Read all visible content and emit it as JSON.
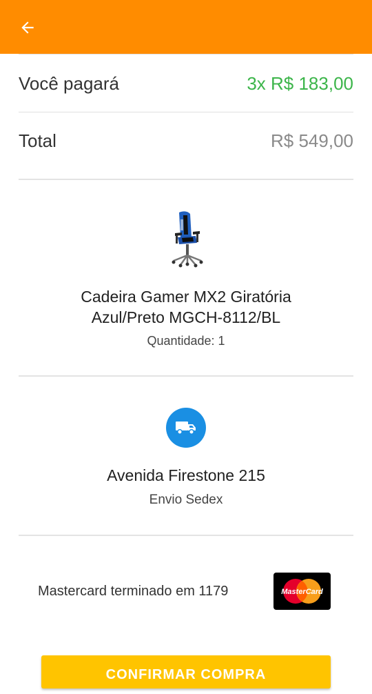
{
  "header": {
    "back_icon": "arrow-left-icon",
    "bg_color": "#ff8c00"
  },
  "summary": {
    "pay_label": "Você pagará",
    "pay_value": "3x R$ 183,00",
    "total_label": "Total",
    "total_value": "R$ 549,00"
  },
  "product": {
    "image_icon": "gaming-chair-image",
    "name_line1": "Cadeira Gamer MX2 Giratória",
    "name_line2": "Azul/Preto MGCH-8112/BL",
    "quantity": "Quantidade: 1"
  },
  "delivery": {
    "icon": "truck-icon",
    "address": "Avenida Firestone 215",
    "method": "Envio Sedex"
  },
  "payment": {
    "card_text": "Mastercard terminado em 1179",
    "card_logo_text": "MasterCard"
  },
  "actions": {
    "confirm_label": "CONFIRMAR COMPRA"
  },
  "colors": {
    "accent": "#ff8c00",
    "price_green": "#3cb54a",
    "button_yellow": "#ffc400",
    "truck_blue": "#1a8fe3"
  }
}
